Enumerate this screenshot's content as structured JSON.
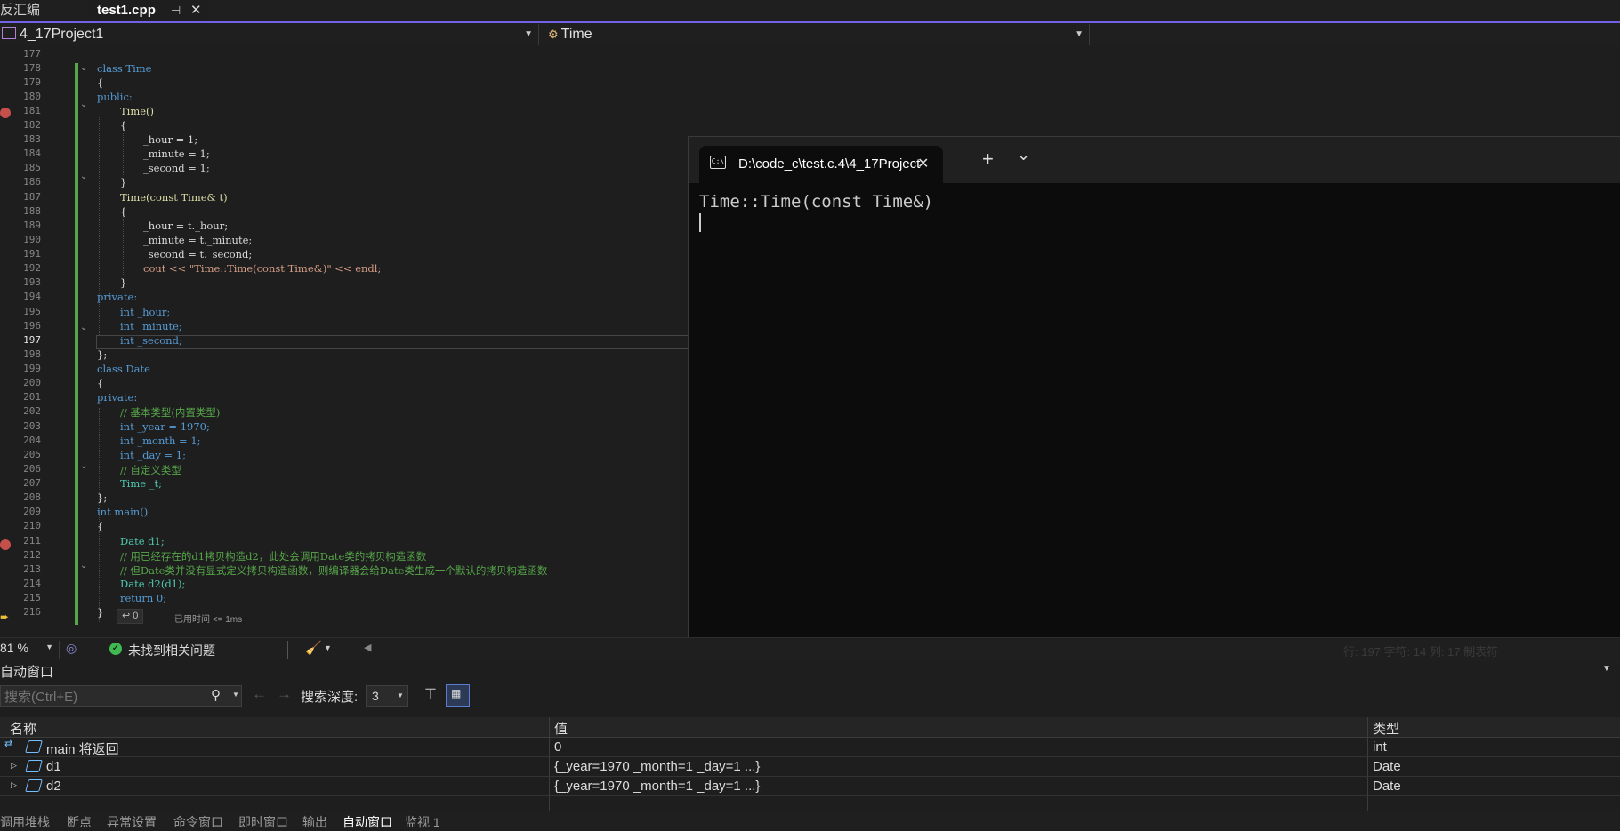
{
  "tabs": {
    "disassembly": "反汇编",
    "active_file": "test1.cpp"
  },
  "nav": {
    "project": "4_17Project1",
    "scope": "Time"
  },
  "code_lines": [
    {
      "n": "177",
      "t": ""
    },
    {
      "n": "178",
      "t": "class Time"
    },
    {
      "n": "179",
      "t": "{"
    },
    {
      "n": "180",
      "t": "public:"
    },
    {
      "n": "181",
      "t": "Time()"
    },
    {
      "n": "182",
      "t": "{"
    },
    {
      "n": "183",
      "t": "_hour = 1;"
    },
    {
      "n": "184",
      "t": "_minute = 1;"
    },
    {
      "n": "185",
      "t": "_second = 1;"
    },
    {
      "n": "186",
      "t": "}"
    },
    {
      "n": "187",
      "t": "Time(const Time& t)"
    },
    {
      "n": "188",
      "t": "{"
    },
    {
      "n": "189",
      "t": "_hour = t._hour;"
    },
    {
      "n": "190",
      "t": "_minute = t._minute;"
    },
    {
      "n": "191",
      "t": "_second = t._second;"
    },
    {
      "n": "192",
      "t": "cout << \"Time::Time(const Time&)\" << endl;"
    },
    {
      "n": "193",
      "t": "}"
    },
    {
      "n": "194",
      "t": "private:"
    },
    {
      "n": "195",
      "t": "int _hour;"
    },
    {
      "n": "196",
      "t": "int _minute;"
    },
    {
      "n": "197",
      "t": "int _second;"
    },
    {
      "n": "198",
      "t": "};"
    },
    {
      "n": "199",
      "t": "class Date"
    },
    {
      "n": "200",
      "t": "{"
    },
    {
      "n": "201",
      "t": "private:"
    },
    {
      "n": "202",
      "t": "// 基本类型(内置类型)"
    },
    {
      "n": "203",
      "t": "int _year = 1970;"
    },
    {
      "n": "204",
      "t": "int _month = 1;"
    },
    {
      "n": "205",
      "t": "int _day = 1;"
    },
    {
      "n": "206",
      "t": "// 自定义类型"
    },
    {
      "n": "207",
      "t": "Time _t;"
    },
    {
      "n": "208",
      "t": "};"
    },
    {
      "n": "209",
      "t": "int main()"
    },
    {
      "n": "210",
      "t": "{"
    },
    {
      "n": "211",
      "t": "Date d1;"
    },
    {
      "n": "212",
      "t": "// 用已经存在的d1拷贝构造d2，此处会调用Date类的拷贝构造函数"
    },
    {
      "n": "213",
      "t": "// 但Date类并没有显式定义拷贝构造函数，则编译器会给Date类生成一个默认的拷贝构造函数"
    },
    {
      "n": "214",
      "t": "Date d2(d1);"
    },
    {
      "n": "215",
      "t": "return 0;"
    },
    {
      "n": "216",
      "t": "}"
    }
  ],
  "editor": {
    "return_hint": "↩ 0",
    "elapsed": "已用时间 <= 1ms"
  },
  "console": {
    "tab_title": "D:\\code_c\\test.c.4\\4_17Project",
    "output": "Time::Time(const Time&)",
    "new_tab": "+",
    "dropdown": "⌄"
  },
  "status": {
    "zoom": "81 %",
    "issues": "未找到相关问题",
    "position_faded": "行: 197    字符: 14    列: 17    制表符"
  },
  "autos": {
    "title": "自动窗口",
    "search_placeholder": "搜索(Ctrl+E)",
    "depth_label": "搜索深度:",
    "depth_value": "3",
    "columns": {
      "name": "名称",
      "value": "值",
      "type": "类型"
    },
    "rows": [
      {
        "name": "main 将返回",
        "value": "0",
        "type": "int"
      },
      {
        "name": "d1",
        "value": "{_year=1970 _month=1 _day=1 ...}",
        "type": "Date"
      },
      {
        "name": "d2",
        "value": "{_year=1970 _month=1 _day=1 ...}",
        "type": "Date"
      }
    ]
  },
  "bottom_tabs": [
    "调用堆栈",
    "断点",
    "异常设置",
    "命令窗口",
    "即时窗口",
    "输出",
    "自动窗口",
    "监视 1"
  ],
  "colors": {
    "accent": "#7160e8",
    "keyword": "#569cd6",
    "type": "#4ec9b0",
    "comment": "#57a64a",
    "string": "#d69d85",
    "breakpoint": "#c5504b"
  }
}
